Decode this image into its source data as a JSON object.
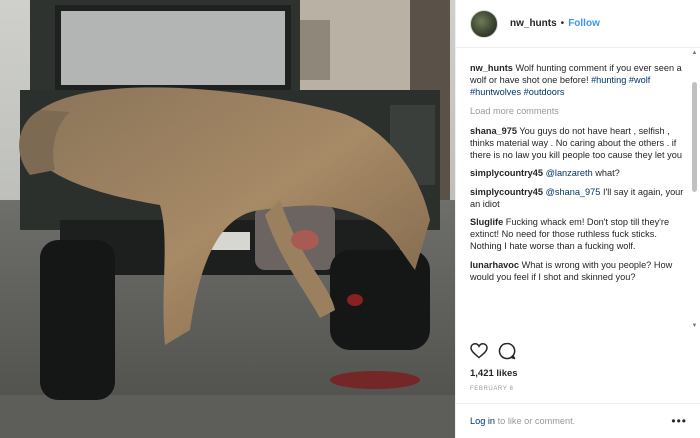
{
  "post": {
    "username": "nw_hunts",
    "separator": "•",
    "follow_label": "Follow",
    "caption": {
      "username": "nw_hunts",
      "text": "Wolf hunting comment if you ever seen a wolf or have shot one before!",
      "hashtags": [
        "#hunting",
        "#wolf",
        "#huntwolves",
        "#outdoors"
      ]
    },
    "load_more_label": "Load more comments",
    "comments": [
      {
        "username": "shana_975",
        "text": "You guys do not have heart , selfish , thinks material way . No caring about the others . if there is no law you kill people too cause they let you"
      },
      {
        "username": "simplycountry45",
        "mention": "@lanzareth",
        "text": "what?"
      },
      {
        "username": "simplycountry45",
        "mention": "@shana_975",
        "text": "I'll say it again, your an idiot"
      },
      {
        "username": "Sluglife",
        "text": "Fucking whack em! Don't stop till they're extinct! No need for those ruthless fuck sticks. Nothing I hate worse than a fucking wolf."
      },
      {
        "username": "lunarhavoc",
        "text": "What is wrong with you people? How would you feel if I shot and skinned you?"
      }
    ],
    "likes": "1,421 likes",
    "date": "FEBRUARY 8",
    "footer": {
      "login_link": "Log in",
      "rest": "to like or comment."
    },
    "more_options": "•••"
  },
  "icons": {
    "like": "heart-icon",
    "comment": "comment-bubble-icon",
    "more": "more-dots-icon"
  },
  "colors": {
    "link_blue": "#3897f0",
    "hashtag": "#003569",
    "muted": "#999999",
    "text": "#262626"
  }
}
